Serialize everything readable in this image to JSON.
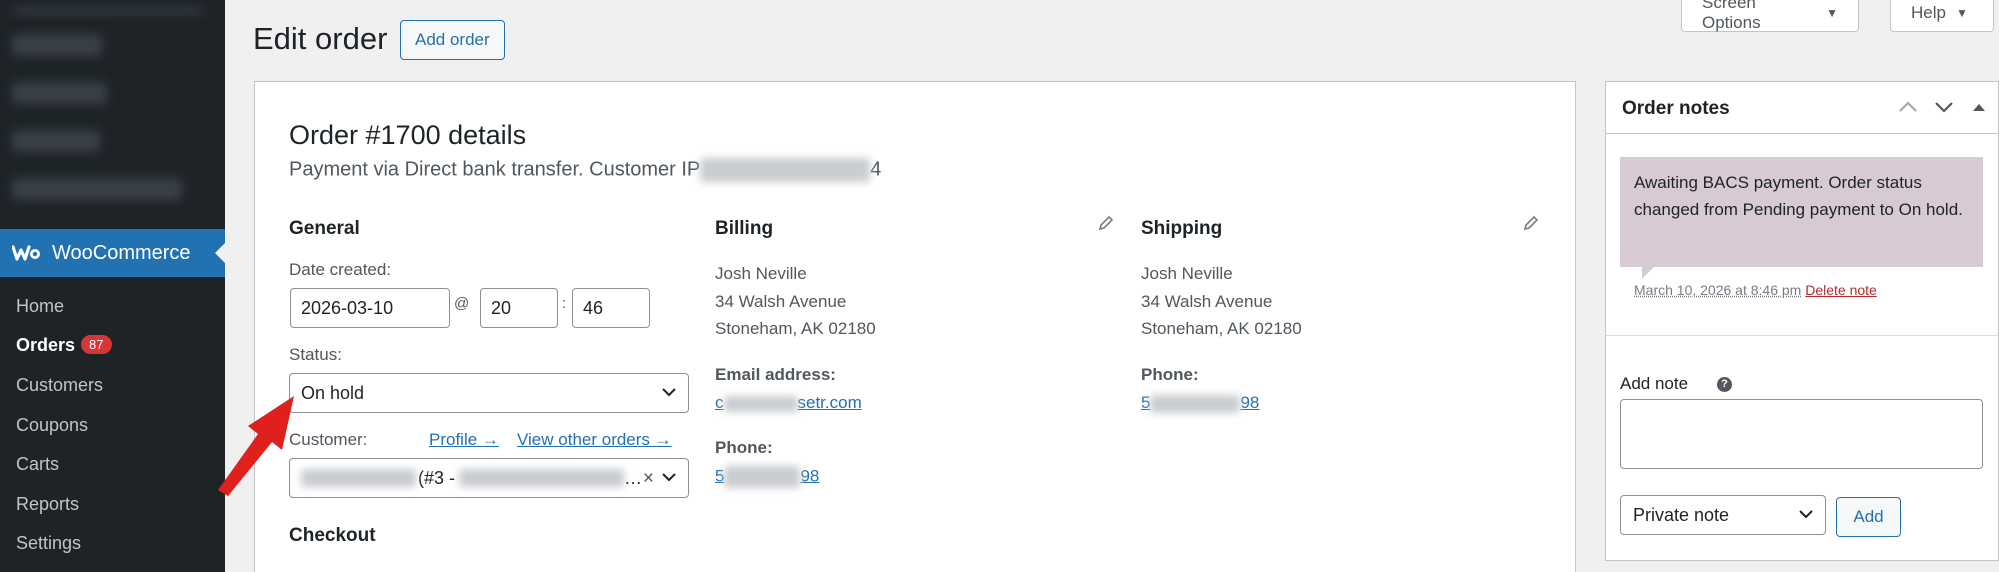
{
  "sidebar": {
    "brand_label": "WooCommerce",
    "items": [
      {
        "label": "Home"
      },
      {
        "label": "Orders",
        "badge": "87"
      },
      {
        "label": "Customers"
      },
      {
        "label": "Coupons"
      },
      {
        "label": "Carts"
      },
      {
        "label": "Reports"
      },
      {
        "label": "Settings"
      }
    ]
  },
  "header": {
    "title": "Edit order",
    "add_order_label": "Add order",
    "screen_options_label": "Screen Options",
    "help_label": "Help"
  },
  "order": {
    "heading": "Order #1700 details",
    "subtitle_prefix": "Payment via Direct bank transfer. Customer IP",
    "subtitle_suffix": "4",
    "general": {
      "title": "General",
      "date_label": "Date created:",
      "date_value": "2026-03-10",
      "at_sep": "@",
      "hour_value": "20",
      "colon_sep": ":",
      "minute_value": "46",
      "status_label": "Status:",
      "status_value": "On hold",
      "customer_label": "Customer:",
      "profile_link": "Profile →",
      "view_orders_link": "View other orders →",
      "customer_value_mid": "(#3 -",
      "customer_value_end": "…",
      "clear_symbol": "×"
    },
    "checkout_title": "Checkout",
    "billing": {
      "title": "Billing",
      "name": "Josh Neville",
      "street": "34 Walsh Avenue",
      "city": "Stoneham, AK 02180",
      "email_label": "Email address:",
      "email_prefix": "c",
      "email_suffix": "setr.com",
      "phone_label": "Phone:",
      "phone_prefix": "5",
      "phone_suffix": "98"
    },
    "shipping": {
      "title": "Shipping",
      "name": "Josh Neville",
      "street": "34 Walsh Avenue",
      "city": "Stoneham, AK 02180",
      "phone_label": "Phone:",
      "phone_prefix": "5",
      "phone_suffix": "98"
    }
  },
  "notes": {
    "title": "Order notes",
    "note_text": "Awaiting BACS payment. Order status changed from Pending payment to On hold.",
    "note_time": "March 10, 2026 at 8:46 pm",
    "delete_label": "Delete note",
    "add_note_label": "Add note",
    "help_glyph": "?",
    "note_type_value": "Private note",
    "add_button_label": "Add"
  },
  "colors": {
    "accent": "#2271b1",
    "sidebar_bg": "#1d2327",
    "note_bg": "#d7cad2",
    "badge_red": "#d63638",
    "arrow_red": "#e0201c"
  }
}
